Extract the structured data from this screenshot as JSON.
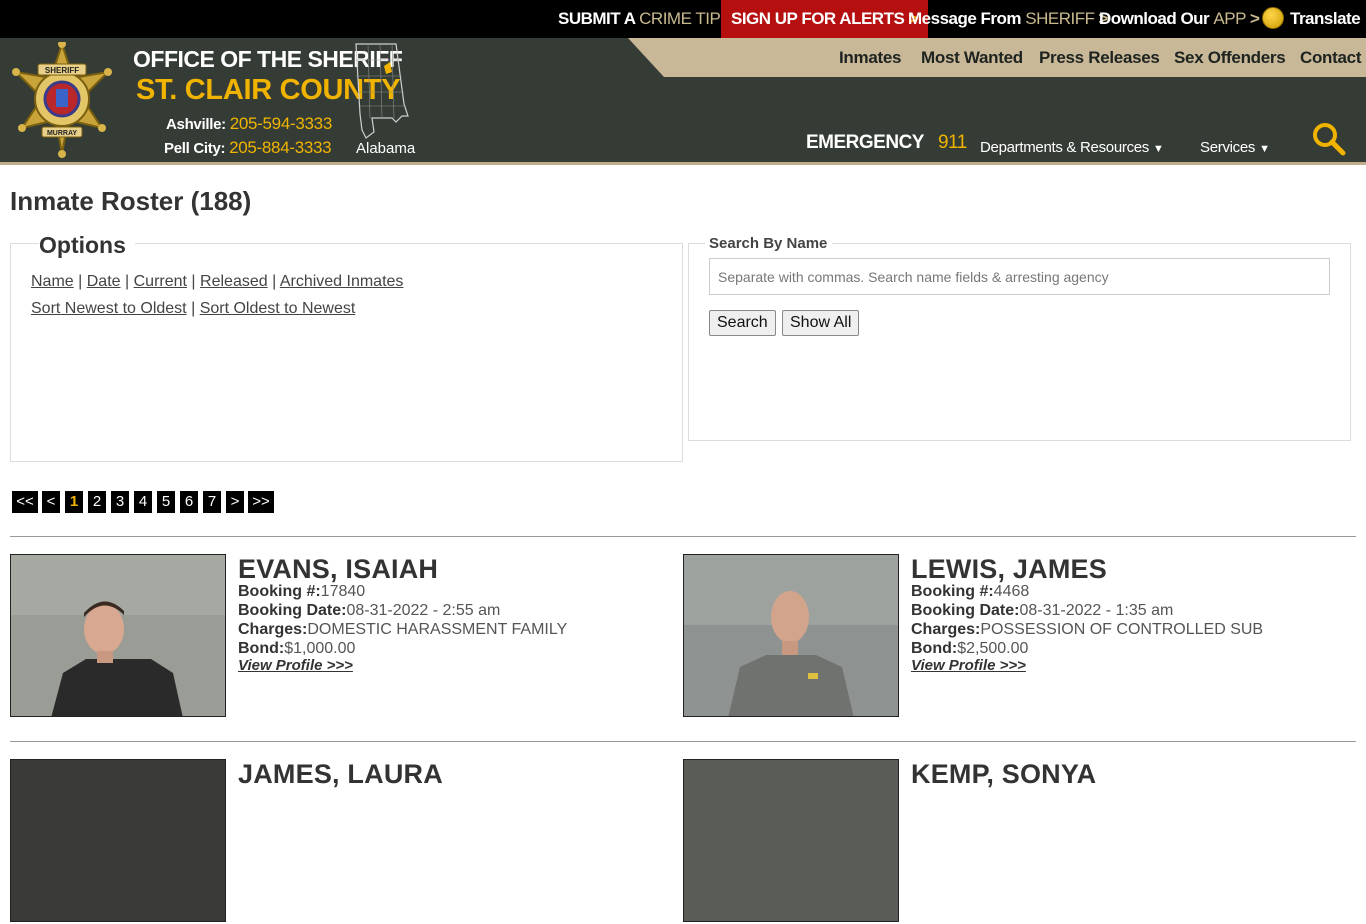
{
  "topbar": {
    "crime_tip_prefix": "SUBMIT A",
    "crime_tip_highlight": "CRIME TIP",
    "alerts_label": "SIGN UP FOR ALERTS",
    "message_prefix": "Message From",
    "message_highlight": "SHERIFF",
    "download_prefix": "Download Our",
    "download_highlight": "APP",
    "translate_label": "Translate",
    "chevron": ">"
  },
  "header": {
    "title_line1": "OFFICE OF THE SHERIFF",
    "title_line2": "ST. CLAIR COUNTY",
    "phone1_label": "Ashville:",
    "phone1_number": "205-594-3333",
    "phone2_label": "Pell City:",
    "phone2_number": "205-884-3333",
    "state_label": "Alabama",
    "badge_top_text": "SHERIFF",
    "badge_bottom_text": "MURRAY",
    "emergency_label": "EMERGENCY",
    "emergency_number": "911",
    "primary_nav": [
      "Inmates",
      "Most Wanted",
      "Press Releases",
      "Sex Offenders",
      "Contact"
    ],
    "dropdowns": [
      "Departments & Resources",
      "Services"
    ]
  },
  "page": {
    "title": "Inmate Roster (188)"
  },
  "options": {
    "legend": "Options",
    "filter_links": [
      "Name",
      "Date",
      "Current",
      "Released",
      "Archived Inmates"
    ],
    "sort_links": [
      "Sort Newest to Oldest",
      "Sort Oldest to Newest"
    ],
    "separator": "|"
  },
  "search": {
    "legend": "Search By Name",
    "placeholder": "Separate with commas. Search name fields & arresting agency",
    "value": "",
    "search_button": "Search",
    "show_all_button": "Show All"
  },
  "pagination": {
    "first": "<<",
    "prev": "<",
    "pages": [
      "1",
      "2",
      "3",
      "4",
      "5",
      "6",
      "7"
    ],
    "current_page": "1",
    "next": ">",
    "last": ">>"
  },
  "field_labels": {
    "booking_number": "Booking #:",
    "booking_date": "Booking Date:",
    "charges": "Charges:",
    "bond": "Bond:",
    "view_profile": "View Profile >>>"
  },
  "inmates": [
    {
      "name": "EVANS, ISAIAH",
      "booking_number": "17840",
      "booking_date": "08-31-2022 - 2:55 am",
      "charges": "DOMESTIC HARASSMENT FAMILY",
      "bond": "$1,000.00"
    },
    {
      "name": "LEWIS, JAMES",
      "booking_number": "4468",
      "booking_date": "08-31-2022 - 1:35 am",
      "charges": "POSSESSION OF CONTROLLED SUB",
      "bond": "$2,500.00"
    },
    {
      "name": "JAMES, LAURA"
    },
    {
      "name": "KEMP, SONYA"
    }
  ],
  "colors": {
    "header_bg": "#353c36",
    "accent_gold": "#f0b400",
    "nav_tan": "#c8b898",
    "alert_red": "#b50f0f"
  }
}
